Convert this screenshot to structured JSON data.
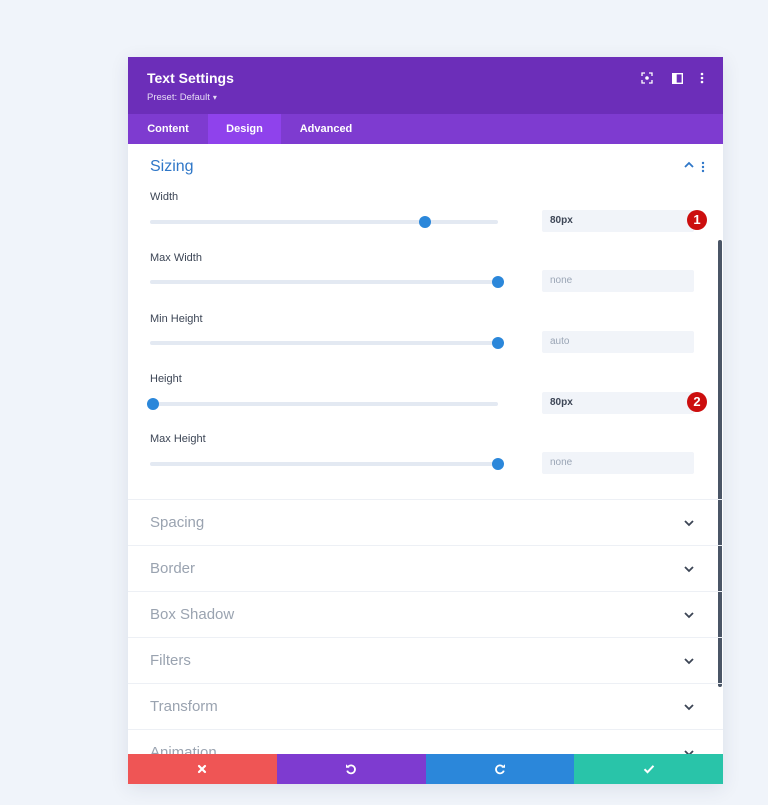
{
  "header": {
    "title": "Text Settings",
    "preset_label": "Preset: Default",
    "icons": [
      "focus-icon",
      "split-view-icon",
      "more-options-icon"
    ]
  },
  "tabs": [
    {
      "label": "Content",
      "active": false
    },
    {
      "label": "Design",
      "active": true
    },
    {
      "label": "Advanced",
      "active": false
    }
  ],
  "sizing": {
    "title": "Sizing",
    "fields": [
      {
        "label": "Width",
        "value": "80px",
        "slider_percent": 79,
        "is_set": true,
        "badge": "1"
      },
      {
        "label": "Max Width",
        "value": "none",
        "slider_percent": 100,
        "is_set": false,
        "badge": ""
      },
      {
        "label": "Min Height",
        "value": "auto",
        "slider_percent": 100,
        "is_set": false,
        "badge": ""
      },
      {
        "label": "Height",
        "value": "80px",
        "slider_percent": 1,
        "is_set": true,
        "badge": "2"
      },
      {
        "label": "Max Height",
        "value": "none",
        "slider_percent": 100,
        "is_set": false,
        "badge": ""
      }
    ]
  },
  "collapsed_sections": [
    "Spacing",
    "Border",
    "Box Shadow",
    "Filters",
    "Transform",
    "Animation"
  ],
  "footer": {
    "buttons": [
      "discard-icon",
      "undo-icon",
      "redo-icon",
      "save-icon"
    ]
  },
  "colors": {
    "header_bg": "#6c2eb9",
    "tabs_bg": "#7e3bd0",
    "active_tab_bg": "#8f42ec",
    "accent_blue": "#2b87da",
    "badge_red": "#cc0e0e",
    "discard_red": "#ef5555",
    "save_green": "#29c4a9"
  }
}
